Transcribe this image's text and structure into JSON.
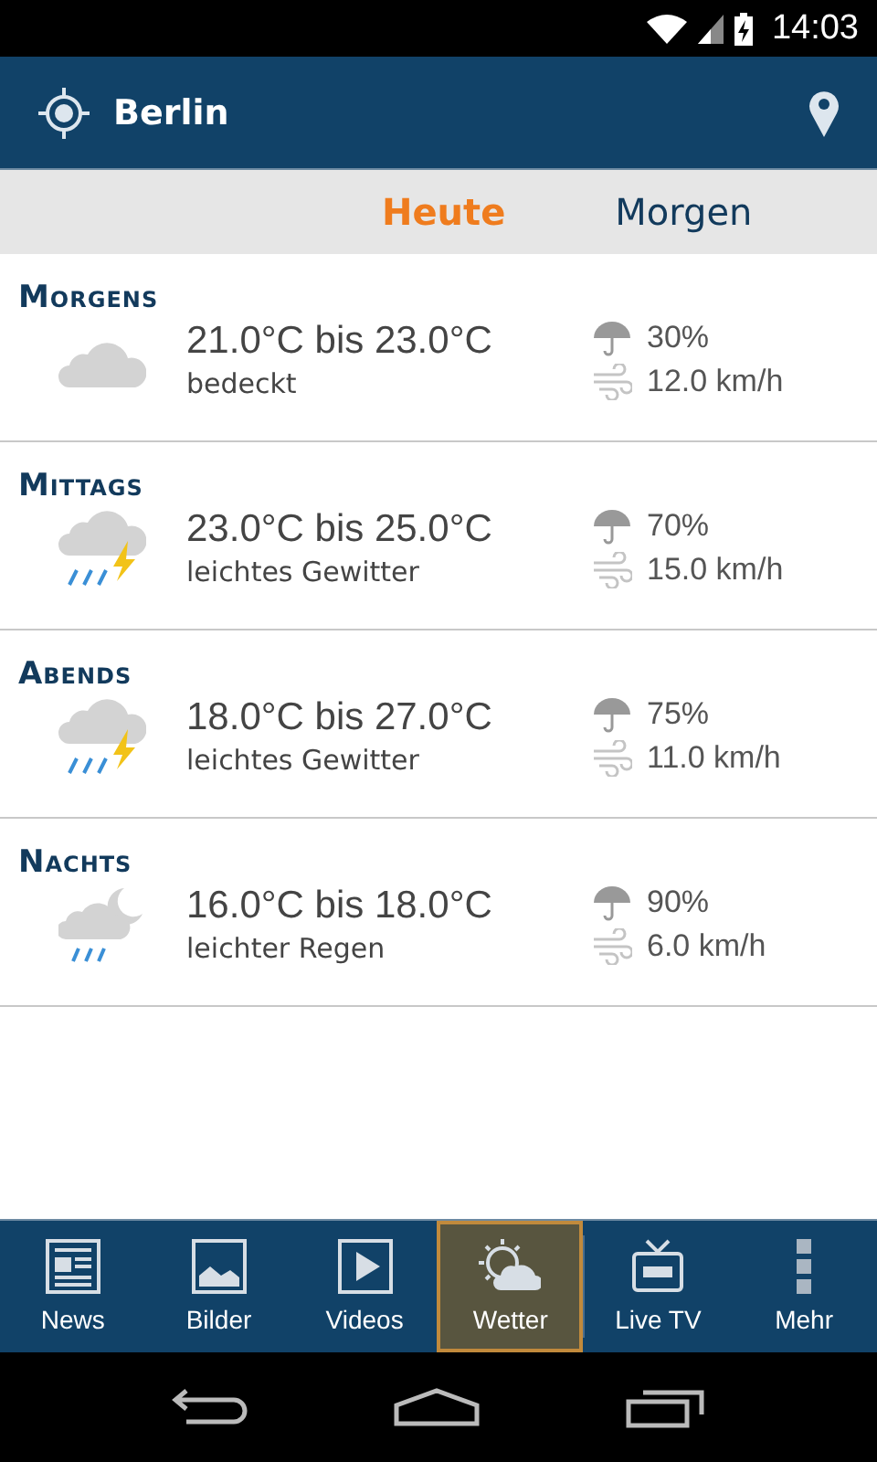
{
  "status_bar": {
    "time": "14:03"
  },
  "header": {
    "city": "Berlin"
  },
  "tabs": [
    {
      "label": "Heute",
      "selected": true
    },
    {
      "label": "Morgen",
      "selected": false
    }
  ],
  "periods": [
    {
      "title": "Morgens",
      "kind": "cloud",
      "temp": "21.0°C bis 23.0°C",
      "condition": "bedeckt",
      "rain": "30%",
      "wind": "12.0 km/h"
    },
    {
      "title": "Mittags",
      "kind": "storm",
      "temp": "23.0°C bis 25.0°C",
      "condition": "leichtes Gewitter",
      "rain": "70%",
      "wind": "15.0 km/h"
    },
    {
      "title": "Abends",
      "kind": "storm",
      "temp": "18.0°C bis 27.0°C",
      "condition": "leichtes Gewitter",
      "rain": "75%",
      "wind": "11.0 km/h"
    },
    {
      "title": "Nachts",
      "kind": "night-rain",
      "temp": "16.0°C bis 18.0°C",
      "condition": "leichter Regen",
      "rain": "90%",
      "wind": "6.0 km/h"
    }
  ],
  "bottom_nav": [
    {
      "label": "News",
      "kind": "news",
      "selected": false
    },
    {
      "label": "Bilder",
      "kind": "pictures",
      "selected": false
    },
    {
      "label": "Videos",
      "kind": "videos",
      "selected": false
    },
    {
      "label": "Wetter",
      "kind": "weather",
      "selected": true
    },
    {
      "label": "Live TV",
      "kind": "tv",
      "selected": false
    },
    {
      "label": "Mehr",
      "kind": "more",
      "selected": false
    }
  ]
}
